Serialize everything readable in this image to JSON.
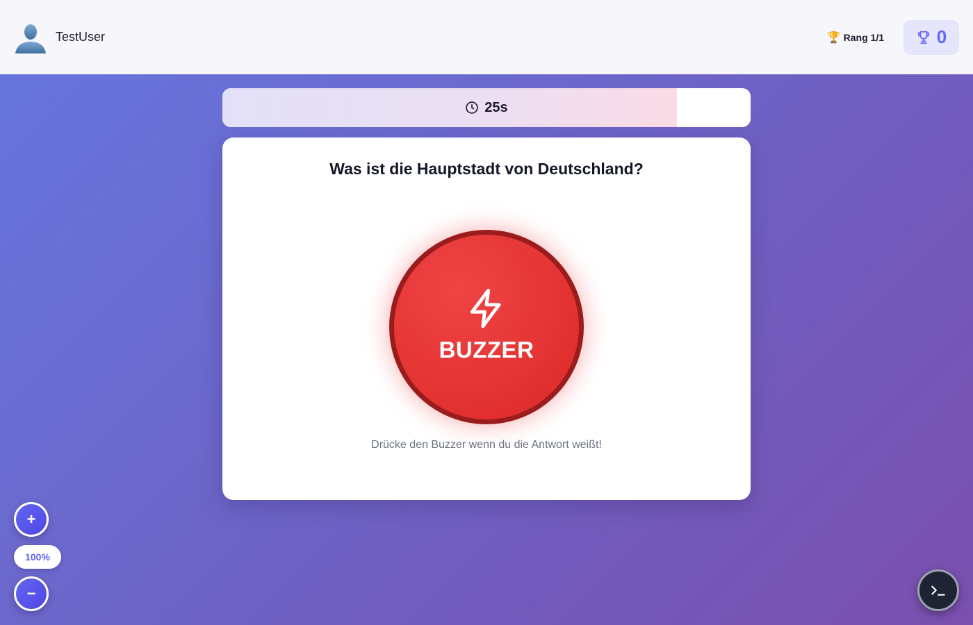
{
  "header": {
    "username": "TestUser",
    "rank_label": "Rang 1/1",
    "score": "0"
  },
  "timer": {
    "label": "25s",
    "remaining_fraction": 0.86
  },
  "question": {
    "text": "Was ist die Hauptstadt von Deutschland?"
  },
  "buzzer": {
    "label": "BUZZER",
    "hint": "Drücke den Buzzer wenn du die Antwort weißt!"
  },
  "zoom": {
    "in_label": "+",
    "out_label": "−",
    "level": "100%"
  },
  "colors": {
    "accent": "#6366f1",
    "buzzer_red": "#e53535",
    "buzzer_border": "#9b1c1c"
  },
  "icons": {
    "avatar": "user-avatar-icon",
    "rank": "trophy-icon",
    "score": "trophy-outline-icon",
    "timer": "clock-icon",
    "buzzer": "lightning-bolt-icon",
    "console": "terminal-icon"
  }
}
